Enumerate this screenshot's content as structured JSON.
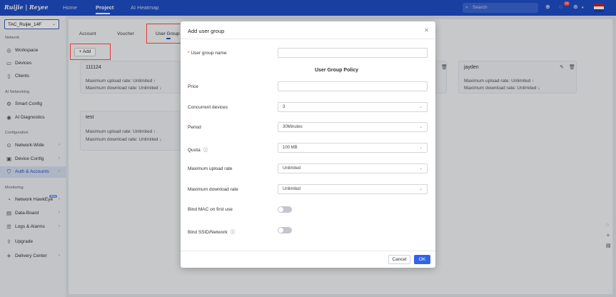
{
  "header": {
    "logo": "Ruijie | Reyee",
    "nav": [
      "Home",
      "Project",
      "AI Heatmap"
    ],
    "search_placeholder": "Search",
    "notification_count": "10"
  },
  "sidebar": {
    "site": "TAC_Ruijie_14F",
    "sections": {
      "network": "Network",
      "ai": "AI Networking",
      "config": "Configuration",
      "monitoring": "Monitoring"
    },
    "items": {
      "workspace": "Workspace",
      "devices": "Devices",
      "clients": "Clients",
      "smart_config": "Smart Config",
      "ai_diagnostics": "AI Diagnostics",
      "network_wide": "Network-Wide",
      "device_config": "Device Config",
      "auth_accounts": "Auth & Accounts",
      "hawkeye": "Network HawkEye",
      "hawkeye_badge": "Beta",
      "data_board": "Data-Board",
      "logs_alarms": "Logs & Alarms",
      "upgrade": "Upgrade",
      "delivery": "Delivery Center"
    }
  },
  "main": {
    "tabs": [
      "Account",
      "Voucher",
      "User Group"
    ],
    "add_label": "+ Add",
    "cards": [
      {
        "title": "111124",
        "upload": "Maximum upload rate: Unlimited ↑",
        "download": "Maximum download rate: Unlimited ↓"
      },
      {
        "title": "test",
        "upload": "Maximum upload rate: Unlimited ↑",
        "download": "Maximum download rate: Unlimited ↓"
      },
      {
        "title": "jayden",
        "upload": "Maximum upload rate: Unlimited ↑",
        "download": "Maximum download rate: Unlimited ↓"
      }
    ]
  },
  "modal": {
    "title": "Add user group",
    "name_label": "User group name",
    "name_required": "*",
    "name_value": "",
    "policy_heading": "User Group Policy",
    "price_label": "Price",
    "price_value": "",
    "concurrent_label": "Concurrent devices",
    "concurrent_value": "3",
    "period_label": "Period",
    "period_value": "30Minutes",
    "quota_label": "Quota",
    "quota_value": "100 MB",
    "upload_label": "Maximum upload rate",
    "upload_value": "Unlimited",
    "download_label": "Maximum download rate",
    "download_value": "Unlimited",
    "bind_mac_label": "Bind MAC on first use",
    "bind_mac_on": false,
    "bind_ssid_label": "Bind SSID/Network",
    "bind_ssid_on": false,
    "cancel": "Cancel",
    "ok": "OK"
  },
  "colors": {
    "brand": "#1f4ec7",
    "primary_button": "#2f66e8",
    "highlight": "#e53935"
  }
}
